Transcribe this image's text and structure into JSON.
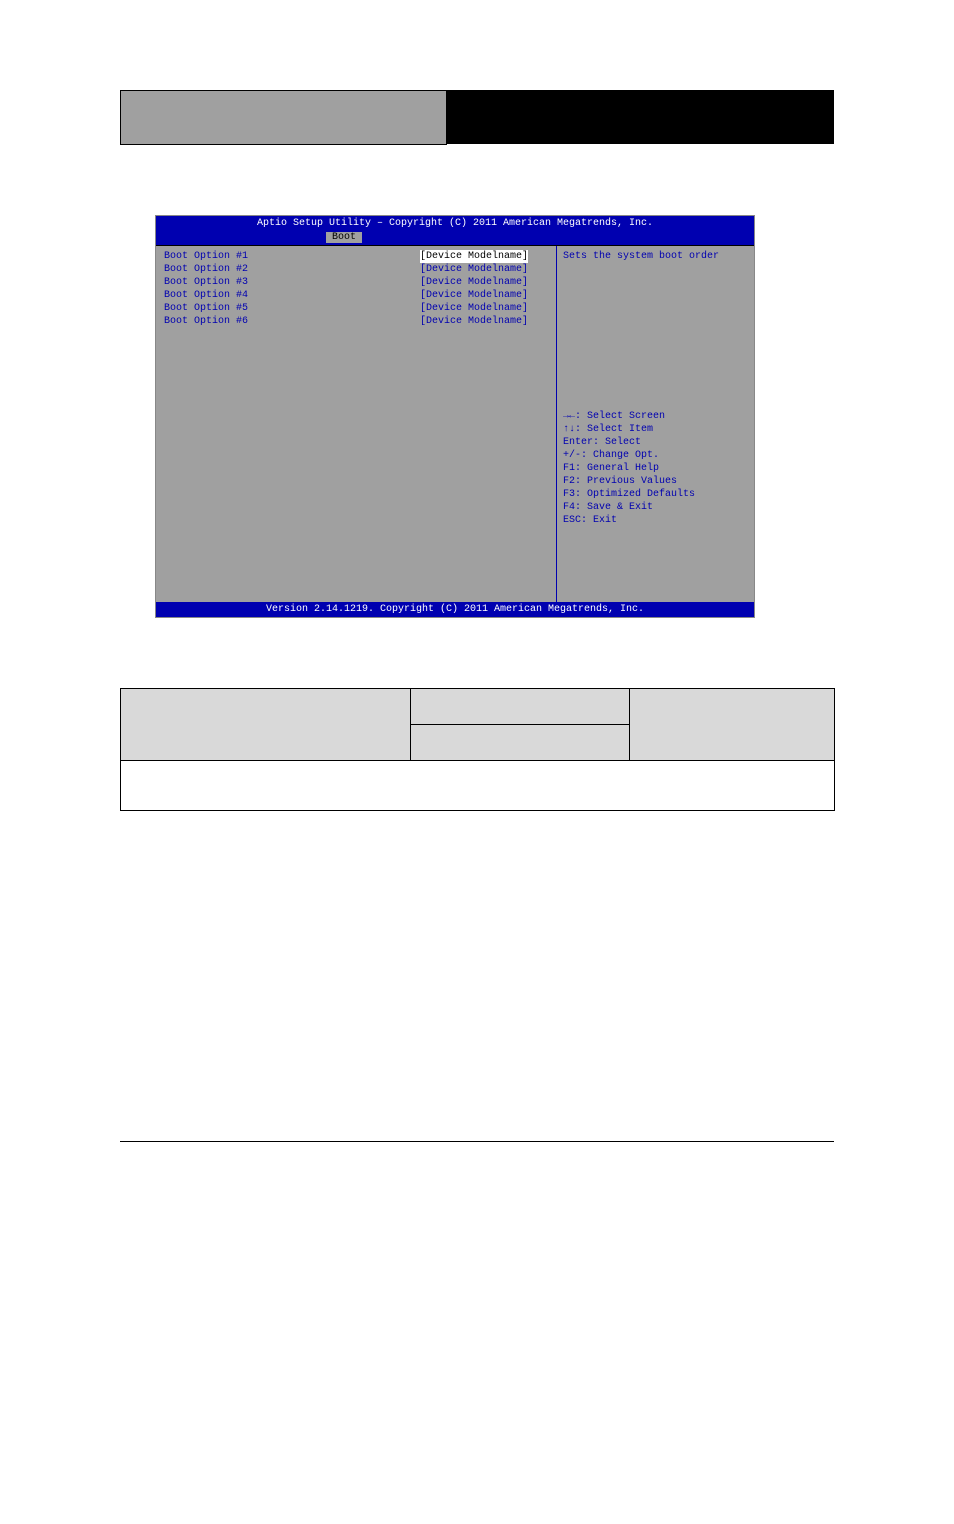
{
  "bios": {
    "title": "Aptio Setup Utility – Copyright (C) 2011 American Megatrends, Inc.",
    "tab": "Boot",
    "options": [
      {
        "label": "Boot Option #1",
        "value": "[Device Modelname]"
      },
      {
        "label": "Boot Option #2",
        "value": "[Device Modelname]"
      },
      {
        "label": "Boot Option #3",
        "value": "[Device Modelname]"
      },
      {
        "label": "Boot Option #4",
        "value": "[Device Modelname]"
      },
      {
        "label": "Boot Option #5",
        "value": "[Device Modelname]"
      },
      {
        "label": "Boot Option #6",
        "value": "[Device Modelname]"
      }
    ],
    "help_text": "Sets the system boot order",
    "nav": [
      "→←: Select Screen",
      "↑↓: Select Item",
      "Enter: Select",
      "+/-: Change Opt.",
      "F1: General Help",
      "F2: Previous Values",
      "F3: Optimized Defaults",
      "F4: Save & Exit",
      "ESC: Exit"
    ],
    "footer": "Version 2.14.1219. Copyright (C) 2011 American Megatrends, Inc."
  }
}
